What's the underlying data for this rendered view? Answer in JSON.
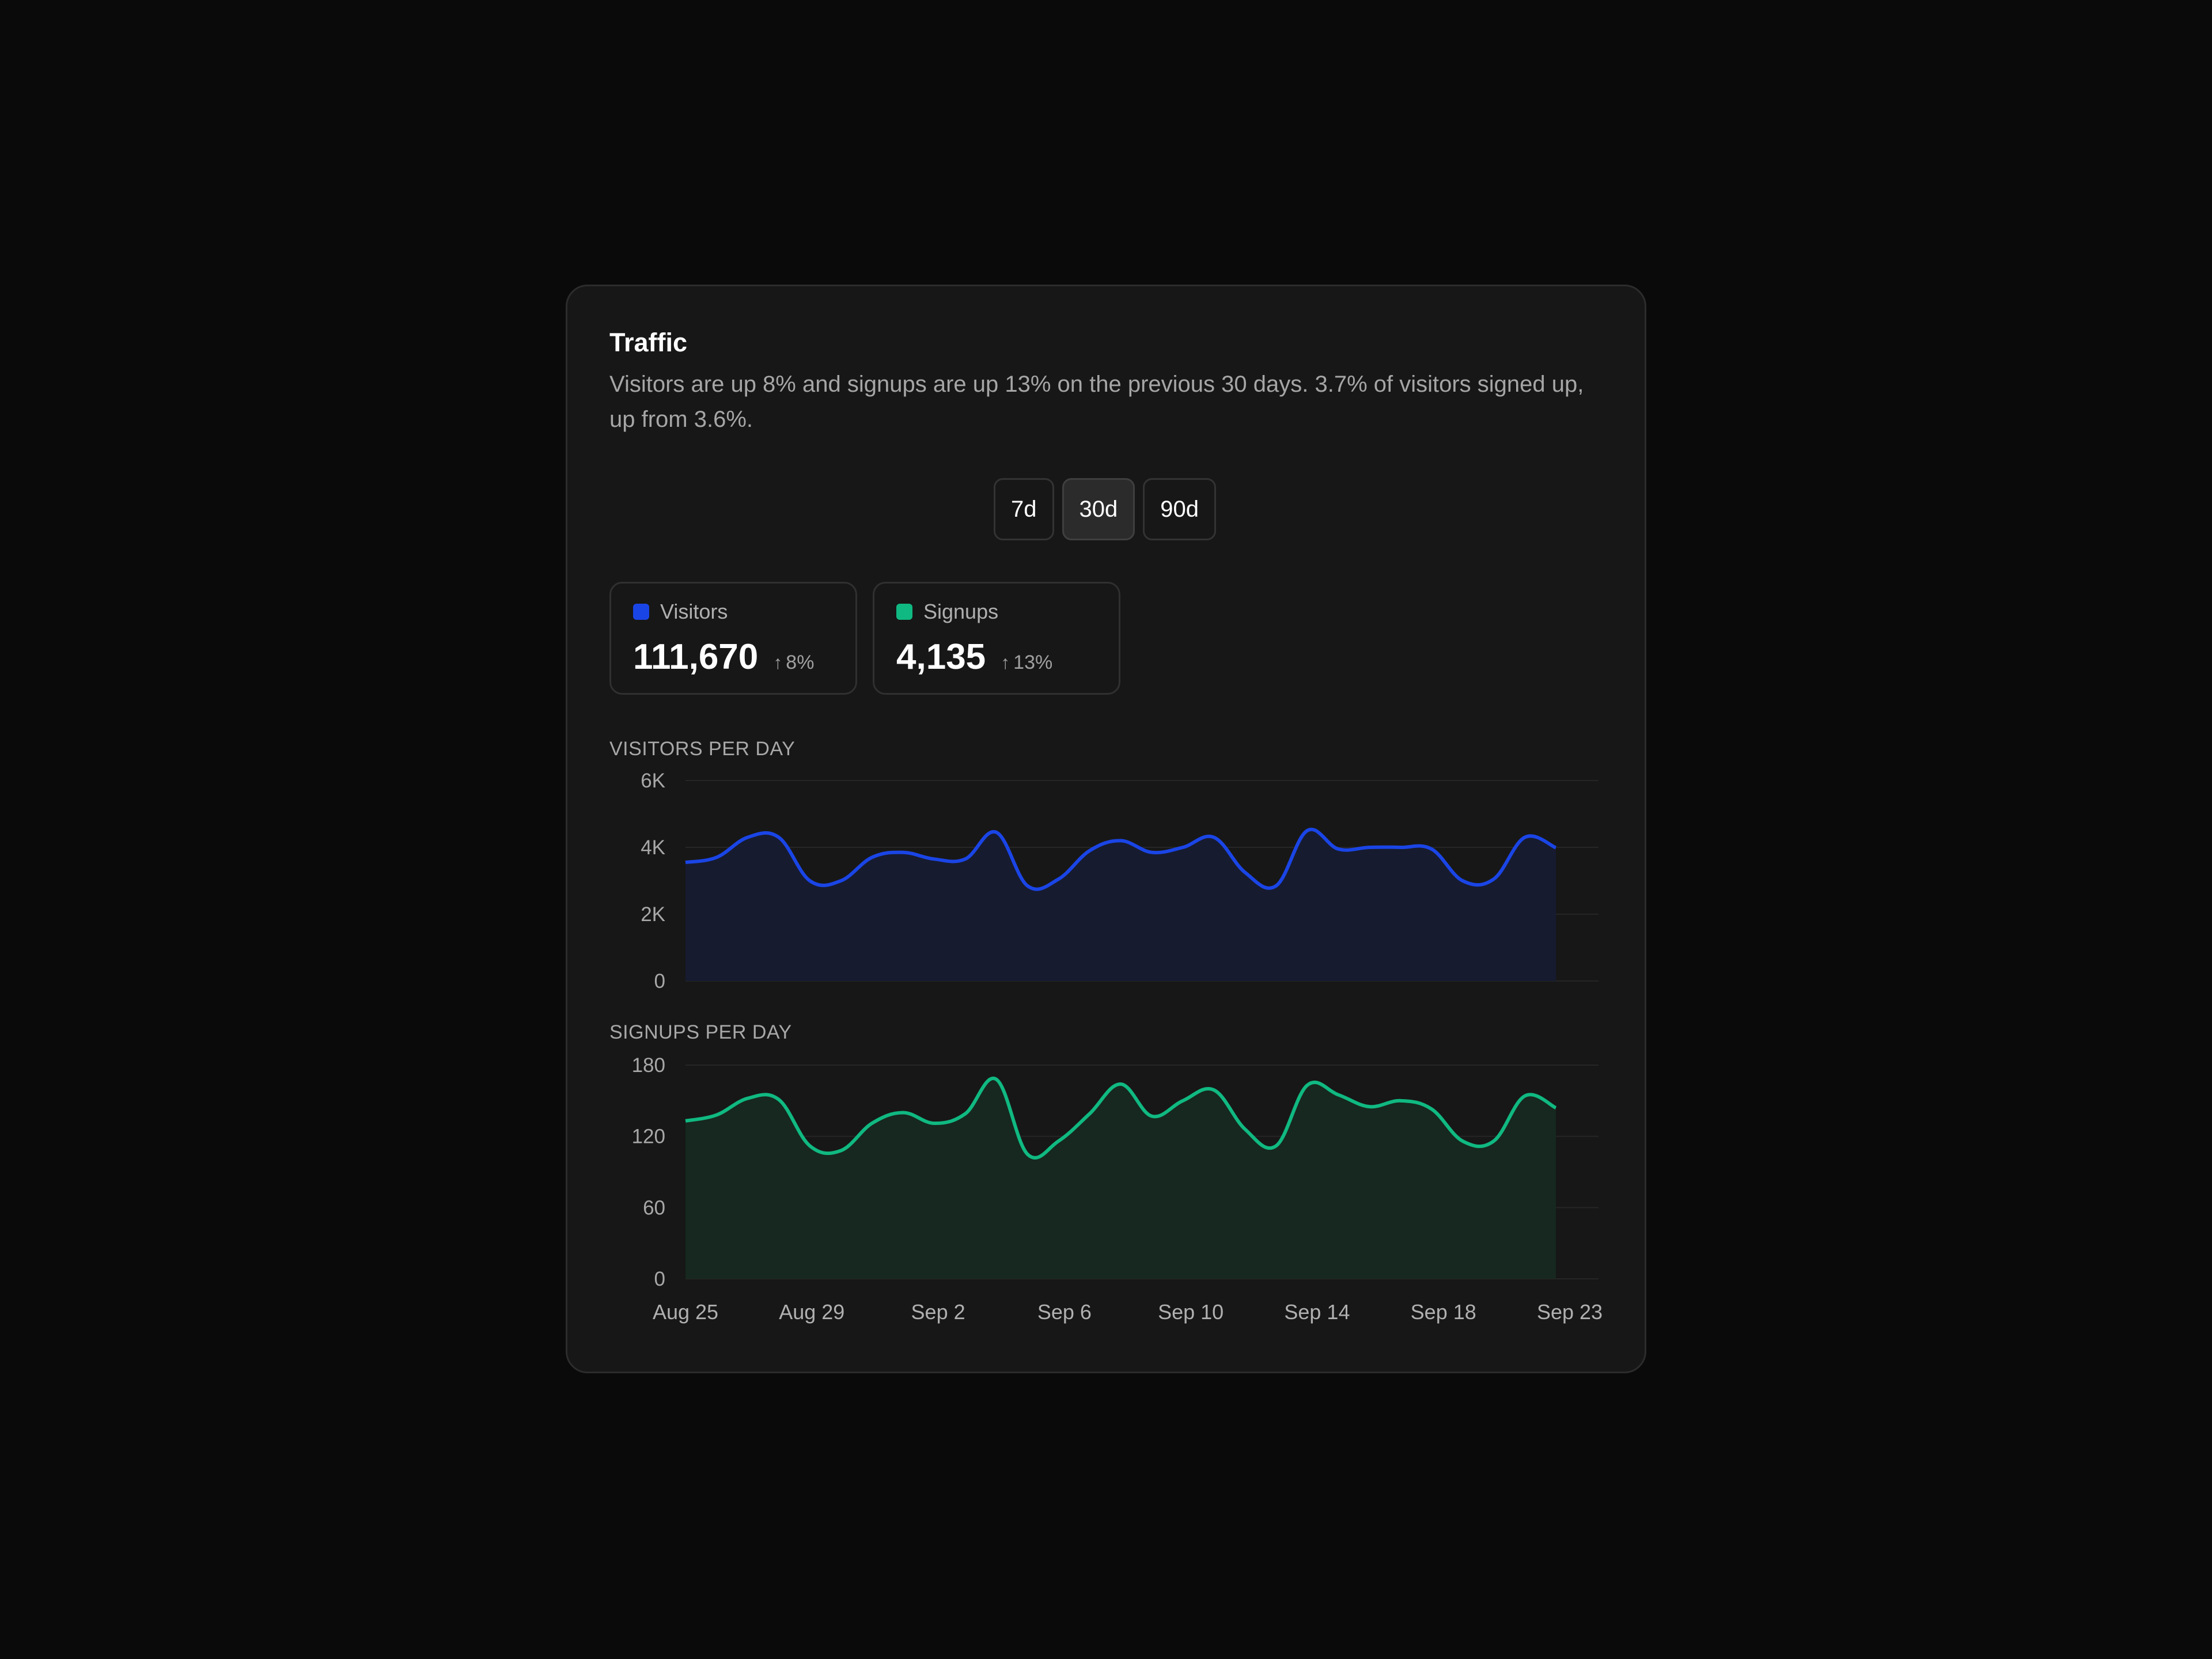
{
  "card": {
    "title": "Traffic",
    "description": "Visitors are up 8% and signups are up 13% on the previous 30 days. 3.7% of visitors signed up, up from 3.6%."
  },
  "range": {
    "options": [
      "7d",
      "30d",
      "90d"
    ],
    "selected": "30d"
  },
  "stats": [
    {
      "label": "Visitors",
      "value": "111,670",
      "delta": "8%",
      "arrow": "↑",
      "color": "#1a45e6"
    },
    {
      "label": "Signups",
      "value": "4,135",
      "delta": "13%",
      "arrow": "↑",
      "color": "#10b981"
    }
  ],
  "chart_data": [
    {
      "type": "area",
      "title": "VISITORS PER DAY",
      "x": [
        "Aug 25",
        "Aug 26",
        "Aug 27",
        "Aug 28",
        "Aug 29",
        "Aug 30",
        "Aug 31",
        "Sep 1",
        "Sep 2",
        "Sep 3",
        "Sep 4",
        "Sep 5",
        "Sep 6",
        "Sep 7",
        "Sep 8",
        "Sep 9",
        "Sep 10",
        "Sep 11",
        "Sep 12",
        "Sep 13",
        "Sep 14",
        "Sep 15",
        "Sep 16",
        "Sep 17",
        "Sep 18",
        "Sep 19",
        "Sep 20",
        "Sep 21",
        "Sep 22"
      ],
      "series": [
        {
          "values": [
            3550,
            3700,
            4300,
            4300,
            3000,
            3000,
            3700,
            3850,
            3650,
            3650,
            4450,
            2850,
            3050,
            3900,
            4200,
            3850,
            4000,
            4300,
            3250,
            2850,
            4500,
            3950,
            4000,
            4000,
            3950,
            3000,
            3050,
            4300,
            3990
          ],
          "color": "#1a45e6",
          "fill": "#161b30"
        }
      ],
      "yticks": [
        "0",
        "2K",
        "4K",
        "6K"
      ],
      "ylim": [
        0,
        6000
      ],
      "xticks": [],
      "grid": true
    },
    {
      "type": "area",
      "title": "SIGNUPS PER DAY",
      "x": [
        "Aug 25",
        "Aug 26",
        "Aug 27",
        "Aug 28",
        "Aug 29",
        "Aug 30",
        "Aug 31",
        "Sep 1",
        "Sep 2",
        "Sep 3",
        "Sep 4",
        "Sep 5",
        "Sep 6",
        "Sep 7",
        "Sep 8",
        "Sep 9",
        "Sep 10",
        "Sep 11",
        "Sep 12",
        "Sep 13",
        "Sep 14",
        "Sep 15",
        "Sep 16",
        "Sep 17",
        "Sep 18",
        "Sep 19",
        "Sep 20",
        "Sep 21",
        "Sep 22"
      ],
      "series": [
        {
          "values": [
            133,
            138,
            152,
            151,
            112,
            108,
            131,
            140,
            131,
            139,
            168,
            105,
            116,
            139,
            164,
            137,
            150,
            159,
            126,
            112,
            163,
            155,
            145,
            150,
            143,
            116,
            116,
            154,
            144
          ],
          "color": "#10b981",
          "fill": "#16281f"
        }
      ],
      "yticks": [
        "0",
        "60",
        "120",
        "180"
      ],
      "ylim": [
        0,
        180
      ],
      "xticks": [
        "Aug 25",
        "Aug 29",
        "Sep 2",
        "Sep 6",
        "Sep 10",
        "Sep 14",
        "Sep 18",
        "Sep 23"
      ],
      "grid": true
    }
  ]
}
